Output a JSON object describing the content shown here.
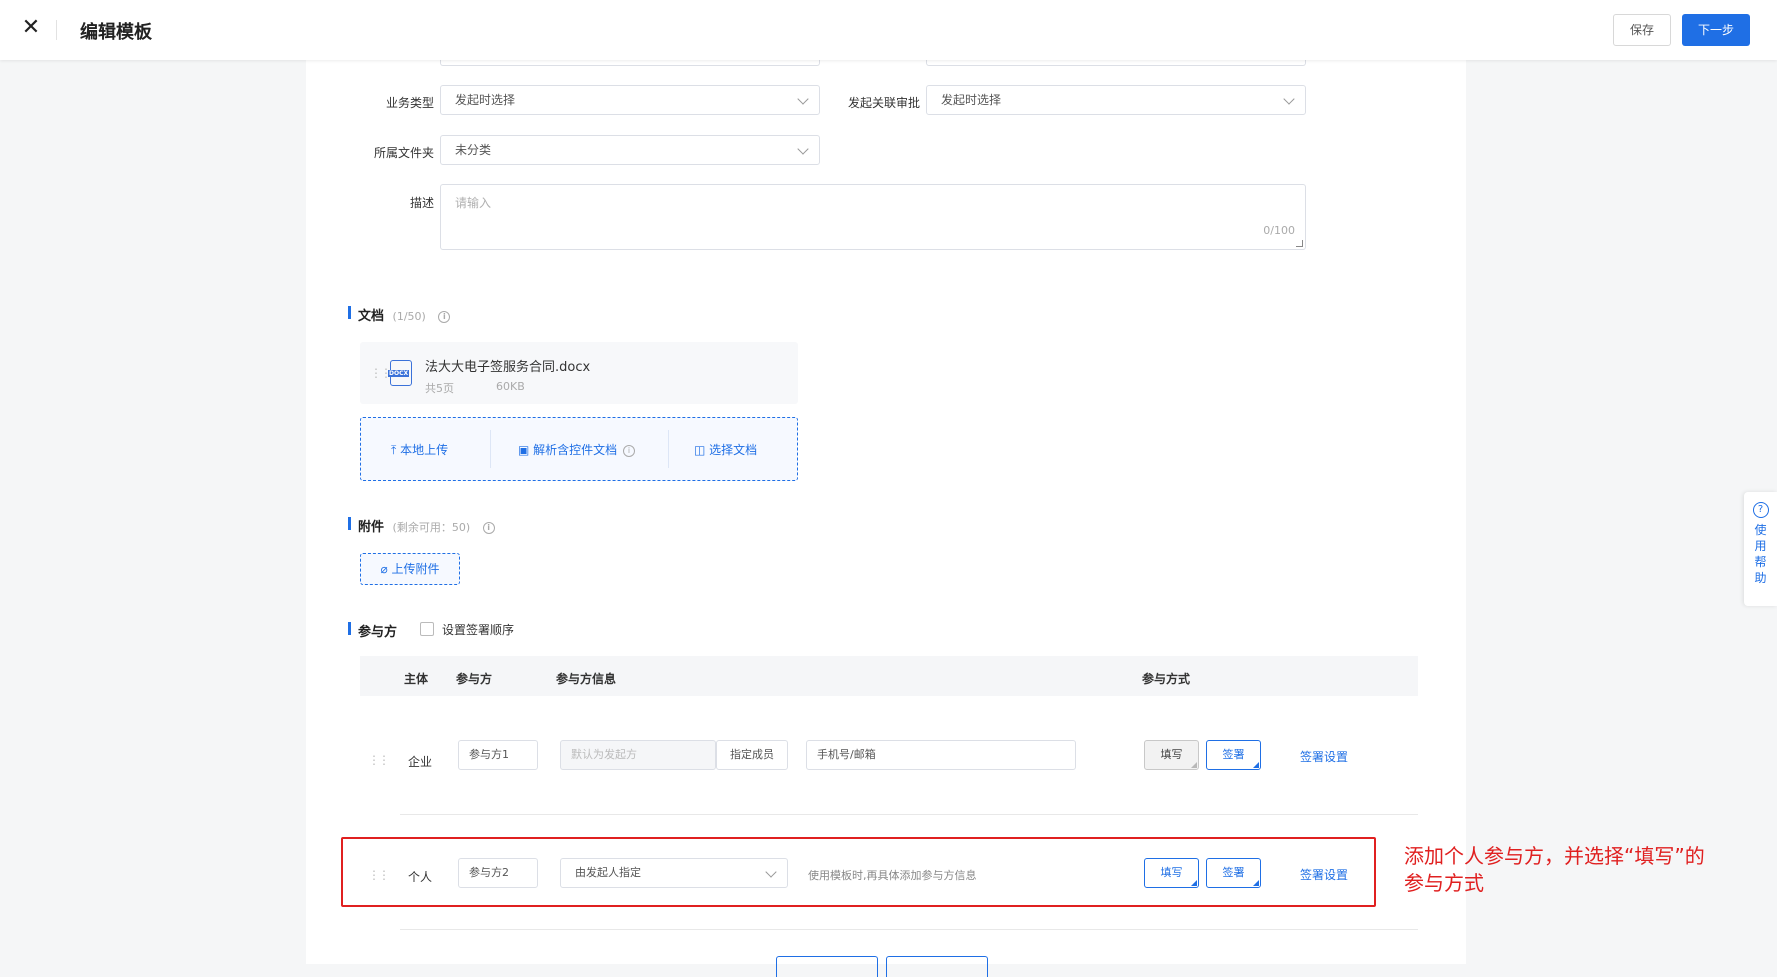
{
  "header": {
    "close_glyph": "✕",
    "title": "编辑模板",
    "save_label": "保存",
    "next_label": "下一步"
  },
  "form": {
    "business_type": {
      "label": "业务类型",
      "value": "发起时选择"
    },
    "approval": {
      "label": "发起关联审批",
      "value": "发起时选择"
    },
    "folder": {
      "label": "所属文件夹",
      "value": "未分类"
    },
    "description": {
      "label": "描述",
      "placeholder": "请输入",
      "counter": "0/100"
    }
  },
  "documents": {
    "title": "文档",
    "count": "(1/50)",
    "file": {
      "name": "法大大电子签服务合同.docx",
      "pages": "共5页",
      "size": "60KB",
      "icon": "docx-file-icon",
      "icon_text": "DOCX"
    },
    "actions": [
      {
        "label": "本地上传",
        "icon": "upload-icon",
        "glyph": "⤒"
      },
      {
        "label": "解析含控件文档",
        "icon": "parse-doc-icon",
        "glyph": "▣"
      },
      {
        "label": "选择文档",
        "icon": "select-doc-icon",
        "glyph": "◫"
      }
    ]
  },
  "attachments": {
    "title": "附件",
    "remaining": "(剩余可用：50)",
    "upload_label": "上传附件",
    "upload_glyph": "⌀"
  },
  "participants": {
    "title": "参与方",
    "order_label": "设置签署顺序",
    "headers": {
      "subject": "主体",
      "party": "参与方",
      "info": "参与方信息",
      "mode": "参与方式"
    },
    "rows": [
      {
        "subject": "企业",
        "party": "参与方1",
        "info_placeholder": "默认为发起方",
        "assign_label": "指定成员",
        "contact_placeholder": "手机号/邮箱",
        "fill_label": "填写",
        "sign_label": "签署",
        "settings_label": "签署设置"
      },
      {
        "subject": "个人",
        "party": "参与方2",
        "designate_value": "由发起人指定",
        "hint": "使用模板时,再具体添加参与方信息",
        "fill_label": "填写",
        "sign_label": "签署",
        "settings_label": "签署设置"
      }
    ]
  },
  "annotation": {
    "text_line1": "添加个人参与方，并选择“填写”的",
    "text_line2": "参与方式",
    "color": "#e02020"
  },
  "help": {
    "glyph": "?",
    "chars": [
      "使",
      "用",
      "帮",
      "助"
    ]
  },
  "colors": {
    "primary": "#1f6fe5",
    "annotation": "#e02020"
  }
}
